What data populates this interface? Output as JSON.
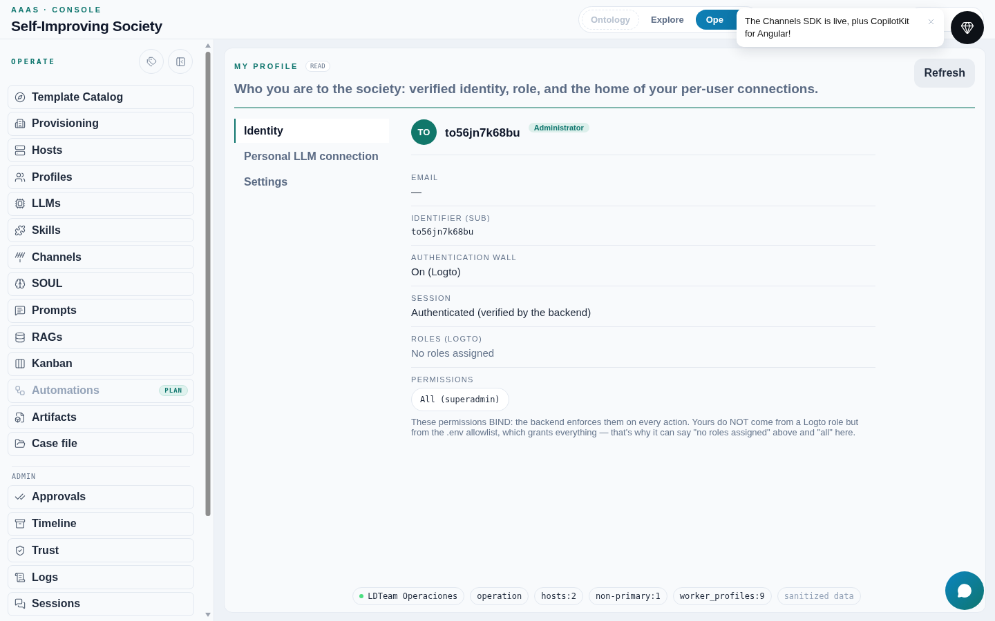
{
  "brand": {
    "eyebrow": "AAAS · CONSOLE",
    "title": "Self-Improving Society"
  },
  "nav": [
    {
      "label": "Ontology",
      "selected": false,
      "disabled": true
    },
    {
      "label": "Explore",
      "selected": false,
      "disabled": false
    },
    {
      "label": "Ope",
      "selected": true,
      "disabled": false
    }
  ],
  "toast": {
    "message": "The Channels SDK is live, plus CopilotKit for Angular!"
  },
  "sidebar": {
    "section": "OPERATE",
    "items": [
      {
        "label": "Template Catalog",
        "disabled": false
      },
      {
        "label": "Provisioning",
        "disabled": false
      },
      {
        "label": "Hosts",
        "disabled": false
      },
      {
        "label": "Profiles",
        "disabled": false
      },
      {
        "label": "LLMs",
        "disabled": false
      },
      {
        "label": "Skills",
        "disabled": false
      },
      {
        "label": "Channels",
        "disabled": false
      },
      {
        "label": "SOUL",
        "disabled": false
      },
      {
        "label": "Prompts",
        "disabled": false
      },
      {
        "label": "RAGs",
        "disabled": false
      },
      {
        "label": "Kanban",
        "disabled": false
      },
      {
        "label": "Automations",
        "disabled": true,
        "badge": "PLAN"
      },
      {
        "label": "Artifacts",
        "disabled": false
      },
      {
        "label": "Case file",
        "disabled": false
      }
    ],
    "admin_section": "ADMIN",
    "admin_items": [
      {
        "label": "Approvals",
        "disabled": false
      },
      {
        "label": "Timeline",
        "disabled": false
      },
      {
        "label": "Trust",
        "disabled": false
      },
      {
        "label": "Logs",
        "disabled": false
      },
      {
        "label": "Sessions",
        "disabled": false
      }
    ]
  },
  "page": {
    "eyebrow": "MY PROFILE",
    "badge": "READ",
    "heading": "Who you are to the society: verified identity, role, and the home of your per-user connections.",
    "refresh": "Refresh",
    "tabs": [
      {
        "label": "Identity",
        "selected": true
      },
      {
        "label": "Personal LLM connection",
        "selected": false
      },
      {
        "label": "Settings",
        "selected": false
      }
    ],
    "user": {
      "initials": "TO",
      "name": "to56jn7k68bu",
      "role": "Administrator"
    },
    "fields": [
      {
        "label": "EMAIL",
        "value": "—",
        "kind": "text"
      },
      {
        "label": "IDENTIFIER (SUB)",
        "value": "to56jn7k68bu",
        "kind": "mono"
      },
      {
        "label": "AUTHENTICATION WALL",
        "value": "On (Logto)",
        "kind": "text"
      },
      {
        "label": "SESSION",
        "value": "Authenticated (verified by the backend)",
        "kind": "text"
      },
      {
        "label": "ROLES (LOGTO)",
        "value": "No roles assigned",
        "kind": "muted"
      },
      {
        "label": "PERMISSIONS",
        "value": "All (superadmin)",
        "kind": "chip"
      }
    ],
    "note": "These permissions BIND: the backend enforces them on every action. Yours do NOT come from a Logto role but from the .env allowlist, which grants everything — that's why it can say \"no roles assigned\" above and \"all\" here."
  },
  "status_chips": [
    {
      "label": "LDTeam Operaciones",
      "color": "#4ade80",
      "dim": false
    },
    {
      "label": "operation",
      "dim": false
    },
    {
      "label": "hosts:2",
      "dim": false
    },
    {
      "label": "non-primary:1",
      "dim": false
    },
    {
      "label": "worker_profiles:9",
      "dim": false
    },
    {
      "label": "sanitized data",
      "dim": true
    }
  ]
}
